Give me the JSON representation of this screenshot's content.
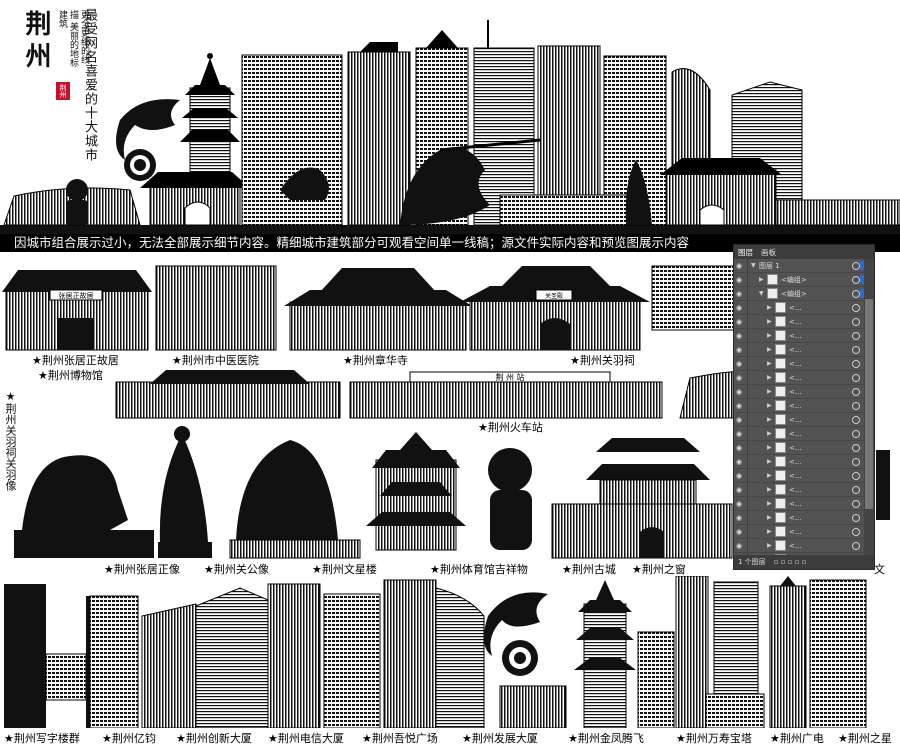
{
  "header": {
    "city_title": "荆州",
    "seal_text": "荆州",
    "tagline_small": "更全更细的线描 美丽的地标建筑",
    "tagline_large": "最受网名喜爱的十大城市"
  },
  "banner": {
    "text": "因城市组合展示过小，无法全部展示细节内容。精细城市建筑部分可观看空间单一线稿；源文件实际内容和预览图展示内容"
  },
  "captions": {
    "row1": [
      "★荆州张居正故居",
      "★荆州市中医医院",
      "★荆州章华寺",
      "★荆州关羽祠"
    ],
    "museum": "★荆州博物馆",
    "station": "★荆州火车站",
    "station_sign": "荆 州 站",
    "gate_sign": "张居正故居",
    "guanyu_sign": "关圣殿",
    "guanyu_statue": "★荆州关羽祠关羽像",
    "row3": [
      "★荆州张居正像",
      "★荆州关公像",
      "★荆州文星楼",
      "★荆州体育馆吉祥物",
      "★荆州古城",
      "★荆州之窗"
    ],
    "row3_partial": "文",
    "row4": [
      "★荆州写字楼群",
      "★荆州亿钧",
      "★荆州创新大厦",
      "★荆州电信大厦",
      "★荆州吾悦广场",
      "★荆州发展大厦",
      "★荆州金凤腾飞",
      "★荆州万寿宝塔",
      "★荆州广电",
      "★荆州之星"
    ]
  },
  "layers_panel": {
    "tabs": [
      "图层",
      "画板"
    ],
    "top_layer": "图层 1",
    "group_label": "<编组>",
    "sub_label": "<...",
    "footer_label": "1 个图层",
    "row_count": 20
  },
  "icons": {
    "visibility": "eye-icon",
    "target": "target-circle-icon",
    "expand": "disclosure-triangle-icon"
  },
  "colors": {
    "ink": "#000000",
    "seal": "#c8102e",
    "panel_bg": "#535353",
    "selection": "#2a6cd6"
  }
}
